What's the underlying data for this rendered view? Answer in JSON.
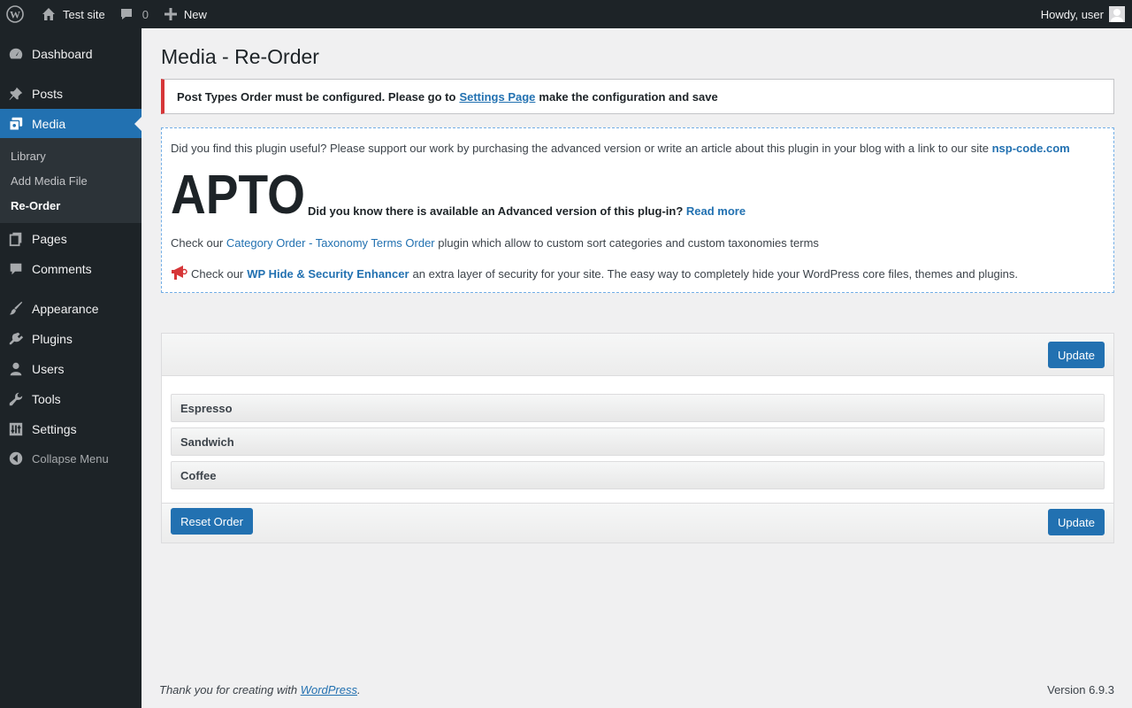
{
  "adminbar": {
    "site_name": "Test site",
    "comments_count": "0",
    "new_label": "New",
    "howdy": "Howdy, user",
    "icons": [
      "wordpress-logo-icon",
      "home-icon",
      "comment-icon",
      "plus-icon",
      "avatar"
    ]
  },
  "sidebar": {
    "items": [
      {
        "label": "Dashboard",
        "icon": "dashboard-icon"
      },
      {
        "label": "Posts",
        "icon": "pin-icon"
      },
      {
        "label": "Media",
        "icon": "media-icon"
      },
      {
        "label": "Pages",
        "icon": "pages-icon"
      },
      {
        "label": "Comments",
        "icon": "comment-icon"
      },
      {
        "label": "Appearance",
        "icon": "brush-icon"
      },
      {
        "label": "Plugins",
        "icon": "plugin-icon"
      },
      {
        "label": "Users",
        "icon": "users-icon"
      },
      {
        "label": "Tools",
        "icon": "wrench-icon"
      },
      {
        "label": "Settings",
        "icon": "settings-icon"
      }
    ],
    "submenu": [
      "Library",
      "Add Media File",
      "Re-Order"
    ],
    "collapse_label": "Collapse Menu"
  },
  "page": {
    "title": "Media - Re-Order"
  },
  "notice": {
    "text_before": "Post Types Order must be configured. Please go to",
    "link": "Settings Page",
    "text_after": "make the configuration and save"
  },
  "promo": {
    "line1": "Did you find this plugin useful? Please support our work by purchasing the advanced version or write an article about this plugin in your blog with a link to our site",
    "line1_link": "nsp-code.com",
    "logo_text": "APTO",
    "line2": "Did you know there is available an Advanced version of this plug-in?",
    "line2_link": "Read more",
    "line3_before": "Check our",
    "line3_link": "Category Order - Taxonomy Terms Order",
    "line3_after": "plugin which allow to custom sort categories and custom taxonomies terms",
    "line4_before": "Check our",
    "line4_link": "WP Hide & Security Enhancer",
    "line4_after": "an extra layer of security for your site. The easy way to completely hide your WordPress core files, themes and plugins."
  },
  "reorder": {
    "update_label": "Update",
    "reset_label": "Reset Order",
    "items": [
      "Espresso",
      "Sandwich",
      "Coffee"
    ]
  },
  "footer": {
    "thanks_before": "Thank you for creating with",
    "thanks_link": "WordPress",
    "thanks_after": ".",
    "version": "Version 6.9.3"
  },
  "colors": {
    "accent": "#2271b1",
    "error": "#d63638",
    "admin_bg": "#1d2327"
  }
}
